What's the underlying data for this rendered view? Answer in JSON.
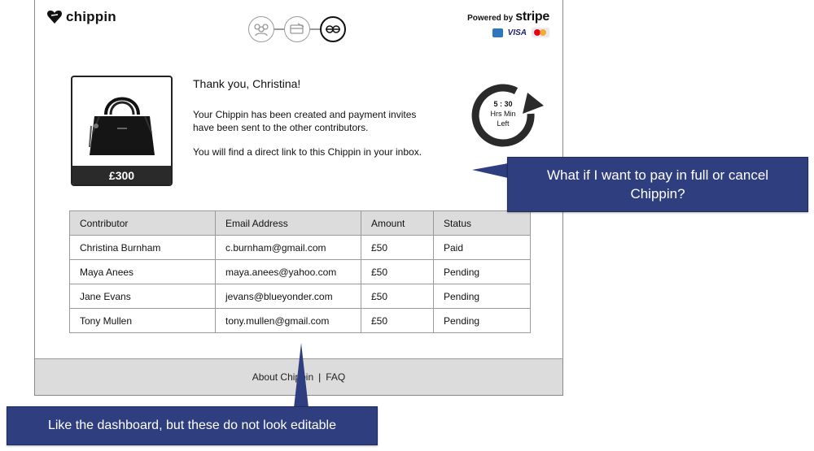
{
  "header": {
    "logo_text": "chippin",
    "steps": [
      "group-icon",
      "card-payment-icon",
      "gift-icon"
    ],
    "active_step": 3,
    "powered_by": "Powered by",
    "stripe": "stripe",
    "cards": {
      "visa": "VISA"
    }
  },
  "product": {
    "price": "£300"
  },
  "confirmation": {
    "title": "Thank you, Christina!",
    "message": "Your Chippin has been created and payment invites have been sent to the other contributors.",
    "inbox_note": "You will find a direct link to this Chippin in your inbox."
  },
  "timer": {
    "time": "5 : 30",
    "units": "Hrs  Min",
    "suffix": "Left"
  },
  "table": {
    "headers": [
      "Contributor",
      "Email Address",
      "Amount",
      "Status"
    ],
    "rows": [
      [
        "Christina Burnham",
        "c.burnham@gmail.com",
        "£50",
        "Paid"
      ],
      [
        "Maya Anees",
        "maya.anees@yahoo.com",
        "£50",
        "Pending"
      ],
      [
        "Jane Evans",
        "jevans@blueyonder.com",
        "£50",
        "Pending"
      ],
      [
        "Tony Mullen",
        "tony.mullen@gmail.com",
        "£50",
        "Pending"
      ]
    ]
  },
  "footer": {
    "about": "About Chippin",
    "separator": "|",
    "faq": "FAQ"
  },
  "annotations": {
    "right": "What if I want to pay in full or cancel Chippin?",
    "bottom": "Like the dashboard, but these do not look editable"
  },
  "colors": {
    "callout": "#2f3e7e",
    "footer_bg": "#dcdcdc",
    "header_bg": "#dcdcdc"
  }
}
